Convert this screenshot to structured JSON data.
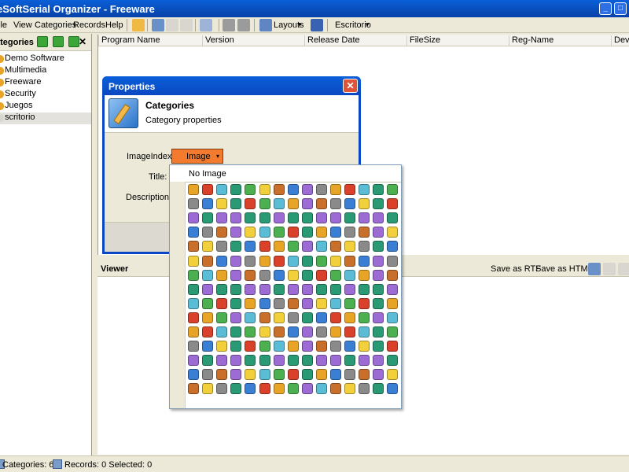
{
  "window": {
    "title": "eSoftSerial Organizer - Freeware",
    "minimize_glyph": "_",
    "maximize_glyph": "□"
  },
  "menu": [
    "ile",
    "View",
    "Categories",
    "Records",
    "Help"
  ],
  "toolbar": {
    "layouts_label": "Layouts",
    "location_label": "Escritorio",
    "dropdown_glyph": "▾"
  },
  "categories_pane": {
    "title": "ategories",
    "close_glyph": "✕",
    "items": [
      {
        "label": "Demo Software",
        "color": "#e8a426"
      },
      {
        "label": "Multimedia",
        "color": "#e8a426"
      },
      {
        "label": "Freeware",
        "color": "#e8a426"
      },
      {
        "label": "Security",
        "color": "#e8a426"
      },
      {
        "label": "Juegos",
        "color": "#e8a426"
      },
      {
        "label": "scritorio",
        "color": "#d8d6cf"
      }
    ]
  },
  "grid": {
    "columns": [
      "Program Name",
      "Version",
      "Release Date",
      "FileSize",
      "Reg-Name",
      "Deve"
    ]
  },
  "viewer": {
    "title": "Viewer",
    "save_rtf": "Save as RTF",
    "save_html": "Save as HTML"
  },
  "status": {
    "categories": "Categories: 6",
    "records": "Records: 0 Selected: 0"
  },
  "dialog": {
    "title": "Properties",
    "close_glyph": "✕",
    "header_title": "Categories",
    "header_subtitle": "Category properties",
    "image_index_label": "ImageIndex:",
    "image_combo_value": "Image",
    "title_label": "Title:",
    "description_label": "Description:"
  },
  "image_popup": {
    "no_image_label": "No Image",
    "palette": [
      "#e8a426",
      "#3b7fd4",
      "#4caf50",
      "#d9412b",
      "#9c6bd3",
      "#f2d03b",
      "#5bbcd6",
      "#8a8a8a",
      "#c86f2c",
      "#2a9a74"
    ]
  }
}
